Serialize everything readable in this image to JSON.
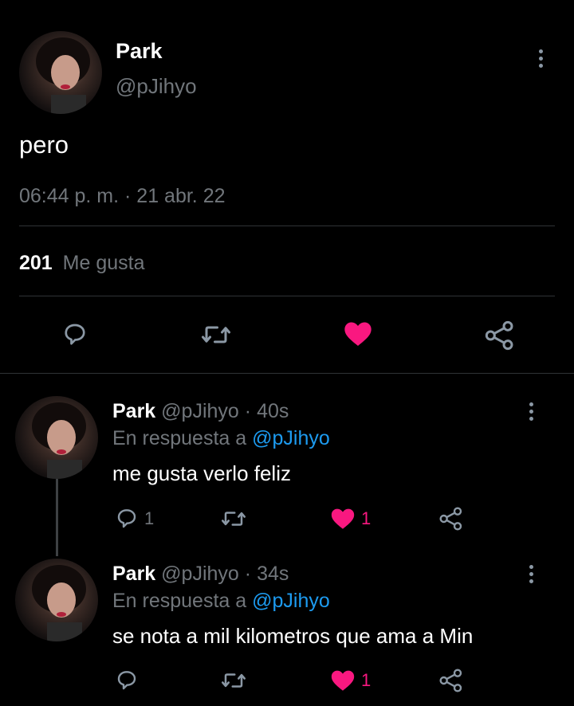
{
  "tweet": {
    "name": "Park",
    "handle": "@pJihyo",
    "text": "pero",
    "timestamp": "06:44 p. m. · 21 abr. 22",
    "likes_count": "201",
    "likes_label": "Me gusta",
    "liked": true,
    "icons": [
      "more-vertical-icon",
      "reply-icon",
      "retweet-icon",
      "heart-filled-icon",
      "share-icon"
    ]
  },
  "replies": [
    {
      "name": "Park",
      "handle": "@pJihyo",
      "sep": "·",
      "time": "40s",
      "replying_prefix": "En respuesta a",
      "replying_to": "@pJihyo",
      "text": "me gusta verlo feliz",
      "reply_count": "1",
      "like_count": "1"
    },
    {
      "name": "Park",
      "handle": "@pJihyo",
      "sep": "·",
      "time": "34s",
      "replying_prefix": "En respuesta a",
      "replying_to": "@pJihyo",
      "text": "se nota a mil kilometros que ama a Min",
      "reply_count": "",
      "like_count": "1"
    }
  ],
  "colors": {
    "background": "#000000",
    "text": "#ffffff",
    "secondary": "#71767b",
    "link": "#1d9bf0",
    "like": "#f91880",
    "divider": "#2f3336"
  }
}
